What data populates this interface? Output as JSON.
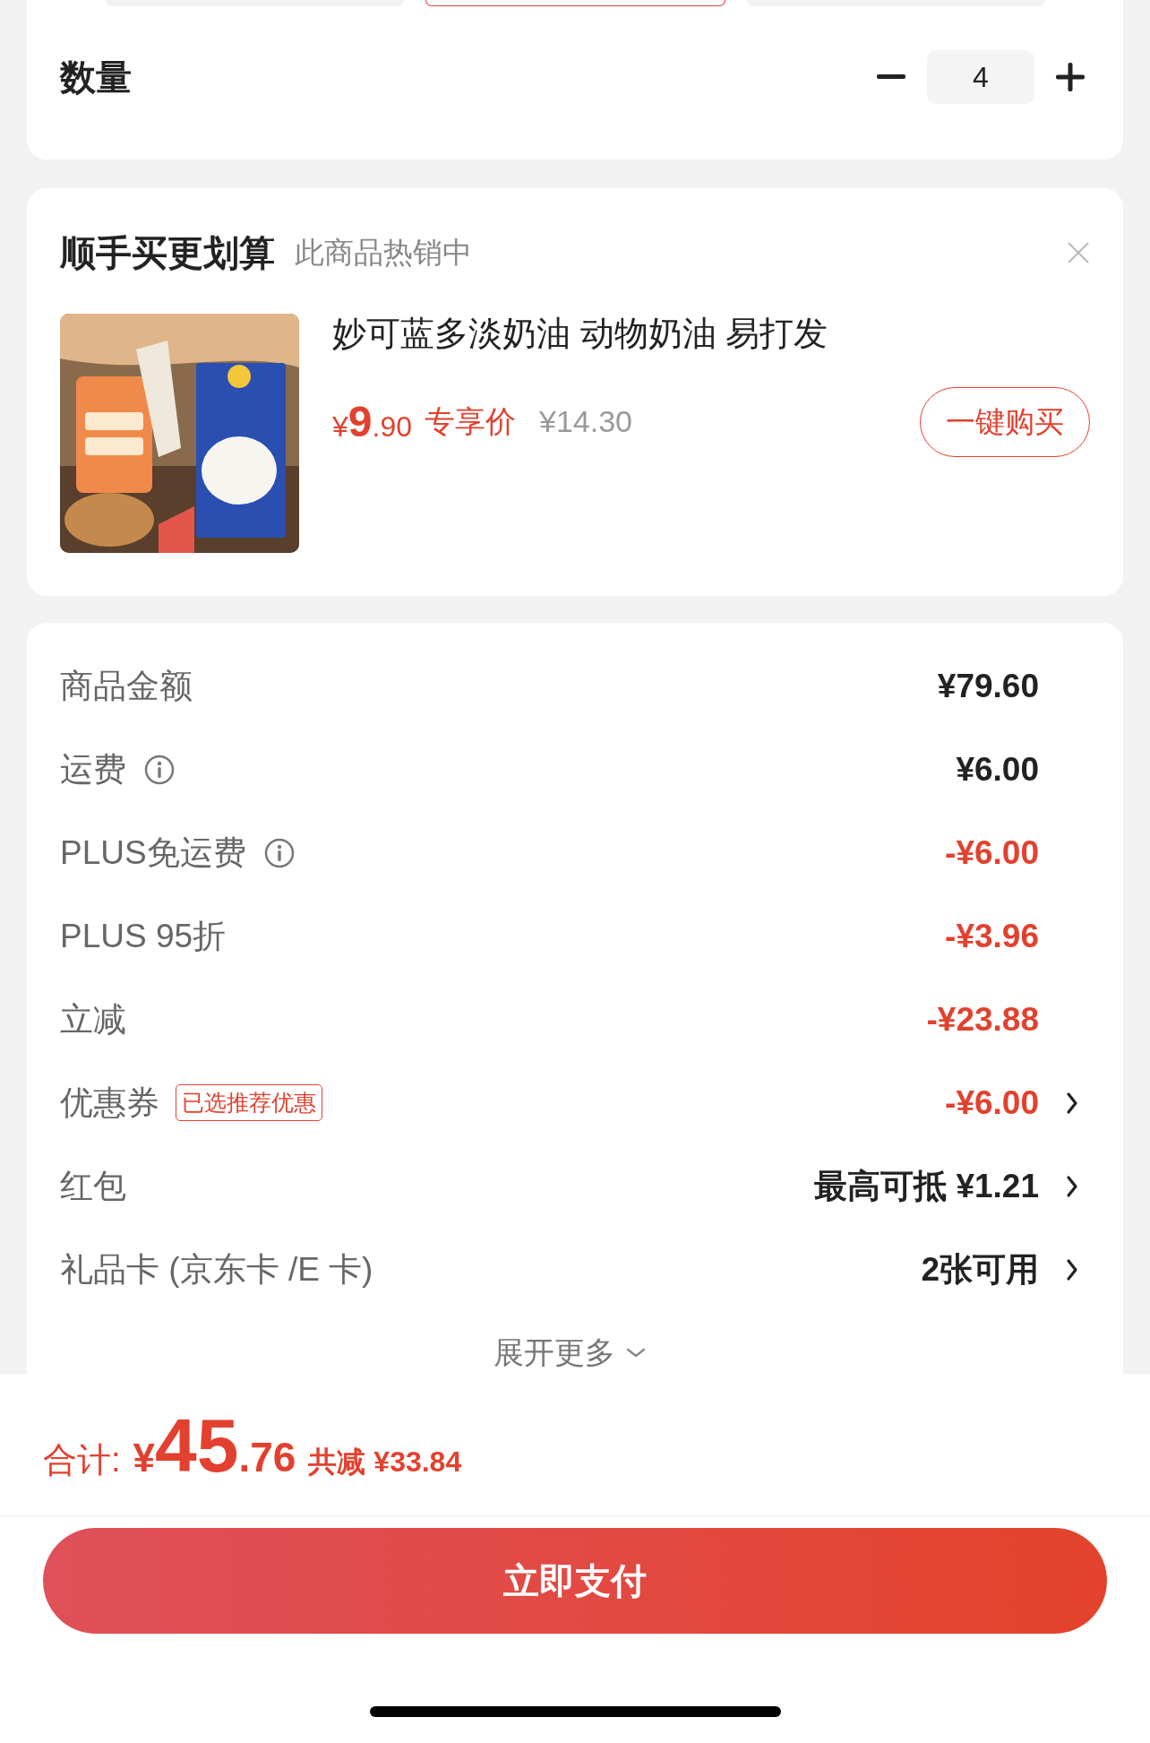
{
  "spec_options": [
    {
      "selected": false
    },
    {
      "selected": true
    },
    {
      "selected": false
    }
  ],
  "quantity": {
    "label": "数量",
    "value": "4"
  },
  "recommend": {
    "title": "顺手买更划算",
    "subtitle": "此商品热销中",
    "product": {
      "name": "妙可蓝多淡奶油 动物奶油 易打发",
      "price_symbol": "¥",
      "price_int": "9",
      "price_dec": ".90",
      "price_tag": "专享价",
      "original_price": "¥14.30",
      "button": "一键购买"
    }
  },
  "summary": {
    "rows": [
      {
        "label": "商品金额",
        "info": false,
        "value": "¥79.60",
        "discount": false,
        "chevron": false
      },
      {
        "label": "运费",
        "info": true,
        "value": "¥6.00",
        "discount": false,
        "chevron": false
      },
      {
        "label": "PLUS免运费",
        "info": true,
        "value": "-¥6.00",
        "discount": true,
        "chevron": false
      },
      {
        "label": "PLUS 95折",
        "info": false,
        "value": "-¥3.96",
        "discount": true,
        "chevron": false
      },
      {
        "label": "立减",
        "info": false,
        "value": "-¥23.88",
        "discount": true,
        "chevron": false
      },
      {
        "label": "优惠券",
        "info": false,
        "tag": "已选推荐优惠",
        "value": "-¥6.00",
        "discount": true,
        "chevron": true
      },
      {
        "label": "红包",
        "info": false,
        "value": "最高可抵 ¥1.21",
        "discount": false,
        "chevron": true
      },
      {
        "label": "礼品卡 (京东卡 /E 卡)",
        "info": false,
        "value": "2张可用",
        "discount": false,
        "chevron": true
      }
    ],
    "expand": "展开更多"
  },
  "total": {
    "label": "合计:",
    "symbol": "¥",
    "int": "45",
    "dec": ".76",
    "saved": "共减 ¥33.84"
  },
  "pay_button": "立即支付"
}
